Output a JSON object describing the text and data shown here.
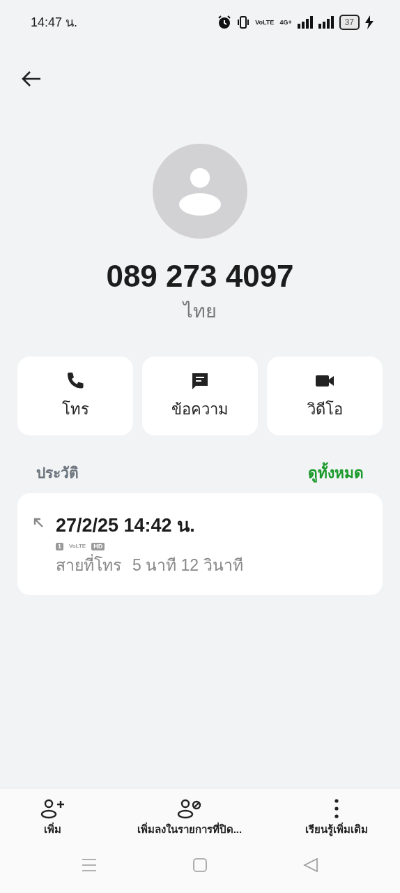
{
  "status_bar": {
    "time": "14:47 น.",
    "volte": "VoLTE",
    "network": "4G+",
    "battery": "37"
  },
  "contact": {
    "number": "089 273 4097",
    "location": "ไทย"
  },
  "actions": [
    {
      "kind": "call",
      "label": "โทร"
    },
    {
      "kind": "message",
      "label": "ข้อความ"
    },
    {
      "kind": "video",
      "label": "วิดีโอ"
    }
  ],
  "history": {
    "title": "ประวัติ",
    "see_all": "ดูทั้งหมด",
    "entries": [
      {
        "outgoing": true,
        "datetime": "27/2/25 14:42 น.",
        "sim": "1",
        "badges": [
          "VoLTE",
          "HD"
        ],
        "type": "สายที่โทร",
        "duration": "5 นาที 12 วินาที"
      }
    ]
  },
  "bottom_actions": [
    {
      "kind": "add",
      "label": "เพิ่ม"
    },
    {
      "kind": "block",
      "label": "เพิ่มลงในรายการที่ปิด..."
    },
    {
      "kind": "more",
      "label": "เรียนรู้เพิ่มเติม"
    }
  ]
}
